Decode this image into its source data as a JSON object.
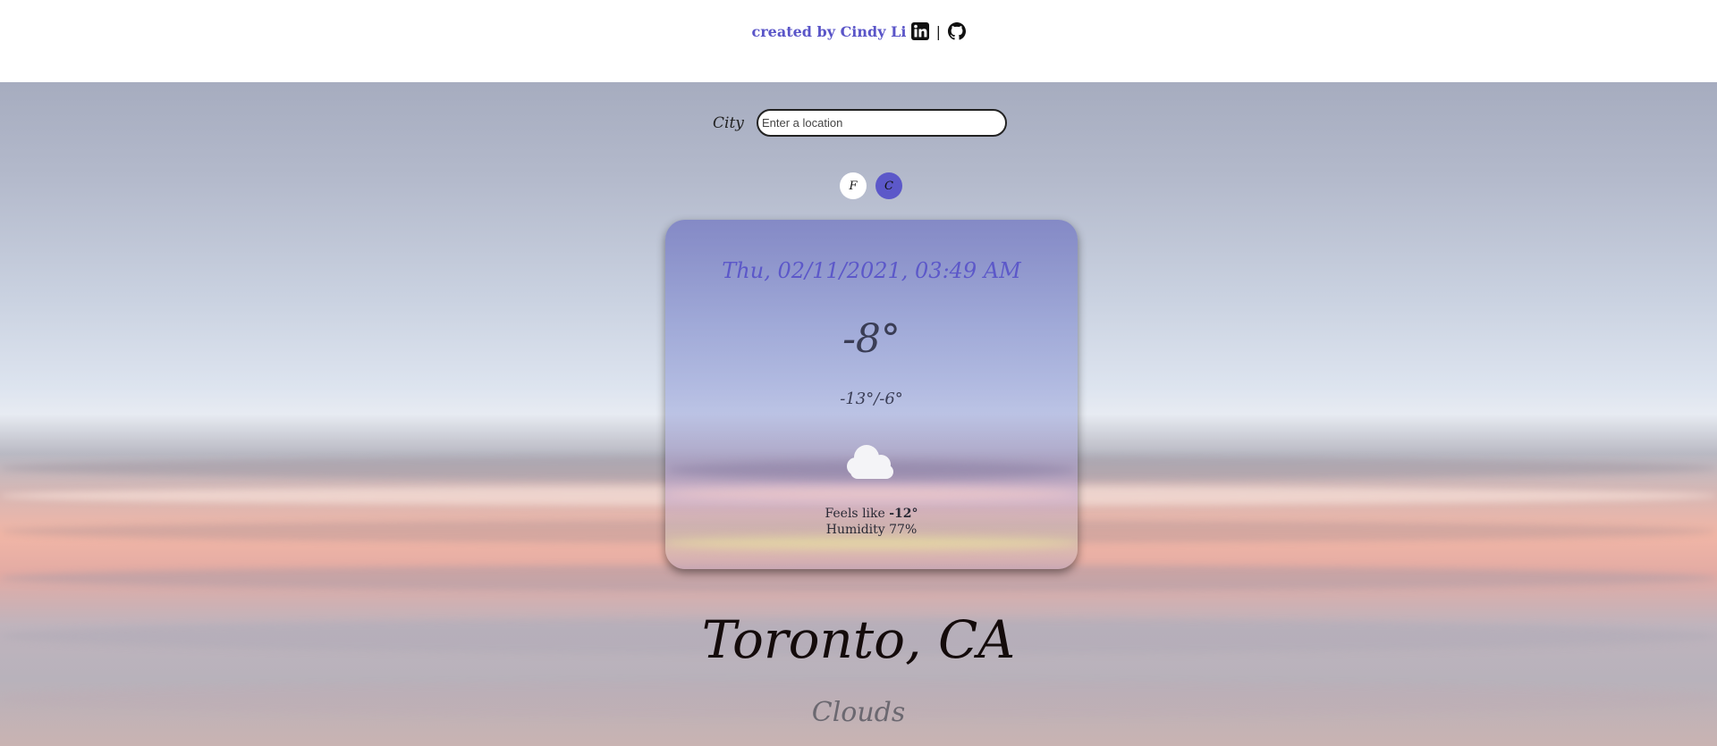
{
  "header": {
    "credit_label": "created by Cindy Li",
    "separator": "|",
    "linkedin_icon": "linkedin-icon",
    "github_icon": "github-icon",
    "credit_color": "#5a55c8"
  },
  "search": {
    "label": "City",
    "placeholder": "Enter a location",
    "value": ""
  },
  "units": {
    "fahrenheit_label": "F",
    "celsius_label": "C",
    "selected": "C",
    "accent_color": "#5c58c9"
  },
  "weather": {
    "datetime": "Thu, 02/11/2021, 03:49 AM",
    "temperature": "-8°",
    "low_high": "-13°/-6°",
    "condition_icon": "cloud-icon",
    "feels_like_label": "Feels like",
    "feels_like_value": "-12°",
    "humidity_label": "Humidity",
    "humidity_value": "77%"
  },
  "location": {
    "name": "Toronto, CA",
    "condition": "Clouds"
  }
}
